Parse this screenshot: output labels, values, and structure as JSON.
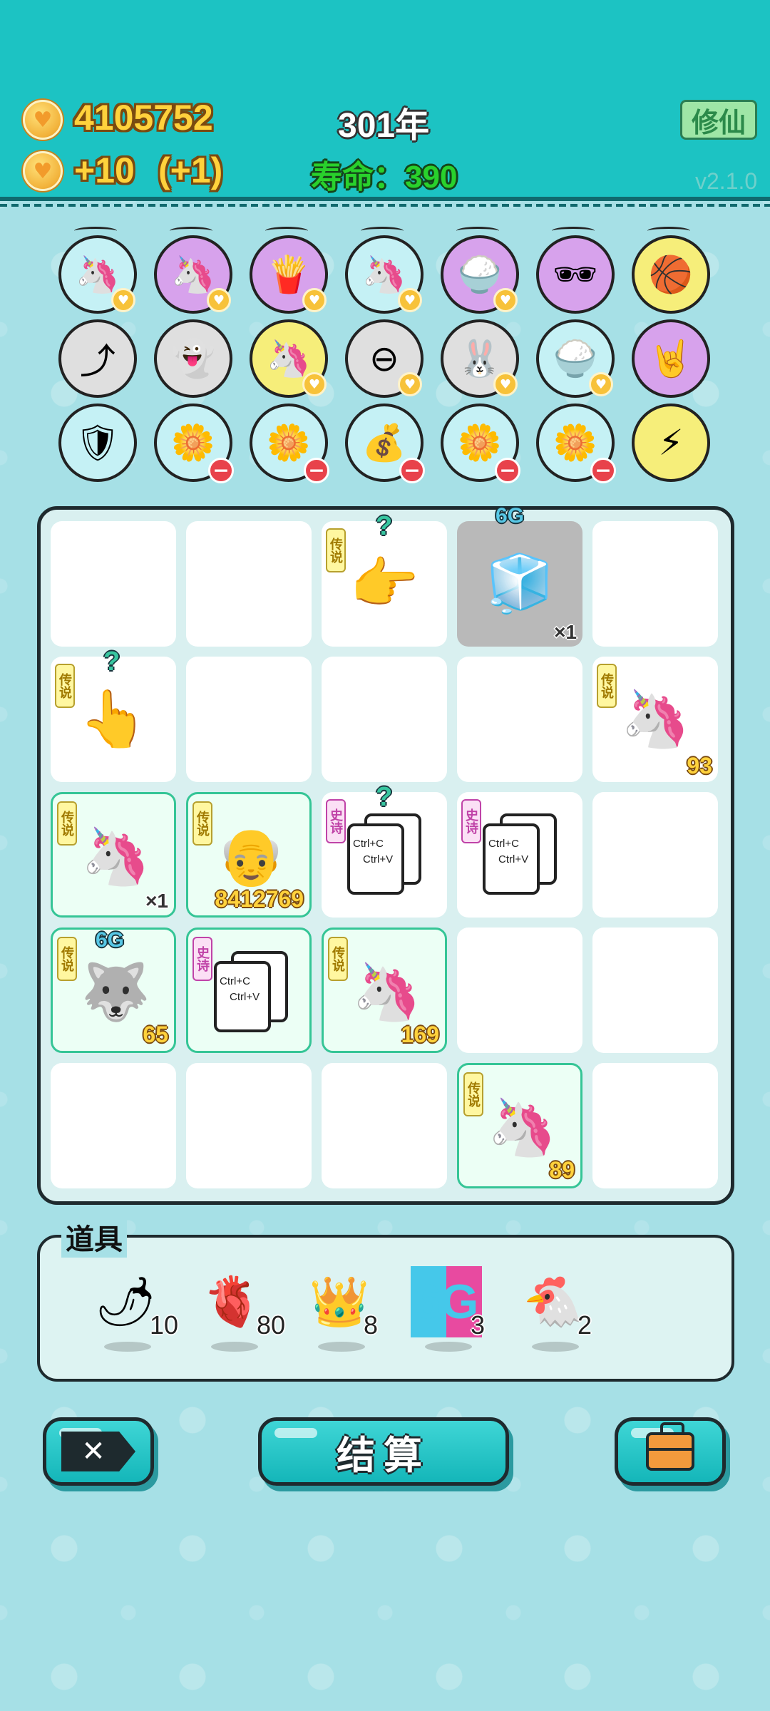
{
  "header": {
    "coins": "4105752",
    "income": "+10",
    "income_bonus": "(+1)",
    "year": "301年",
    "lifespan_label": "寿命：",
    "lifespan_value": "390",
    "cultivate_button": "修仙",
    "version": "v2.1.0"
  },
  "skills": {
    "row1": [
      "unicorn-pair",
      "unicorn-pair",
      "french-fries",
      "unicorn-pair",
      "rice-bowl",
      "mooncake-sunglasses",
      "basketballs"
    ],
    "row2": [
      "arrow-up-card",
      "ghost",
      "unicorn",
      "minus-circle",
      "rabbit",
      "rice-bowl",
      "rock-hand"
    ],
    "row3": [
      "shield-wrench",
      "potted-flower",
      "potted-flower",
      "money-sack",
      "potted-flower",
      "potted-flower",
      "lightning"
    ]
  },
  "board": {
    "tag_legend": "传说",
    "tag_epic": "史诗",
    "ctrl_c": "Ctrl+C",
    "ctrl_v": "Ctrl+V",
    "q_mark": "?",
    "sixg": "6G",
    "counts": {
      "fridge": "×1",
      "unicorn_r2": "93",
      "crown_unicorn_r3": "×1",
      "grandpa": "8412769",
      "husky": "65",
      "crown_unicorn_r4": "169",
      "crown_unicorn_r5": "89"
    }
  },
  "items_panel": {
    "title": "道具",
    "items": [
      {
        "icon": "chili-pepper",
        "count": "10"
      },
      {
        "icon": "liver",
        "count": "80"
      },
      {
        "icon": "crown",
        "count": "8"
      },
      {
        "icon": "6g",
        "label": "6G",
        "count": "3"
      },
      {
        "icon": "duck",
        "count": "2"
      }
    ]
  },
  "buttons": {
    "settle": "结算"
  },
  "colors": {
    "header": "#1cc3c3",
    "background": "#a6e0e6",
    "gold": "#ffd23c",
    "green": "#29d12c"
  }
}
